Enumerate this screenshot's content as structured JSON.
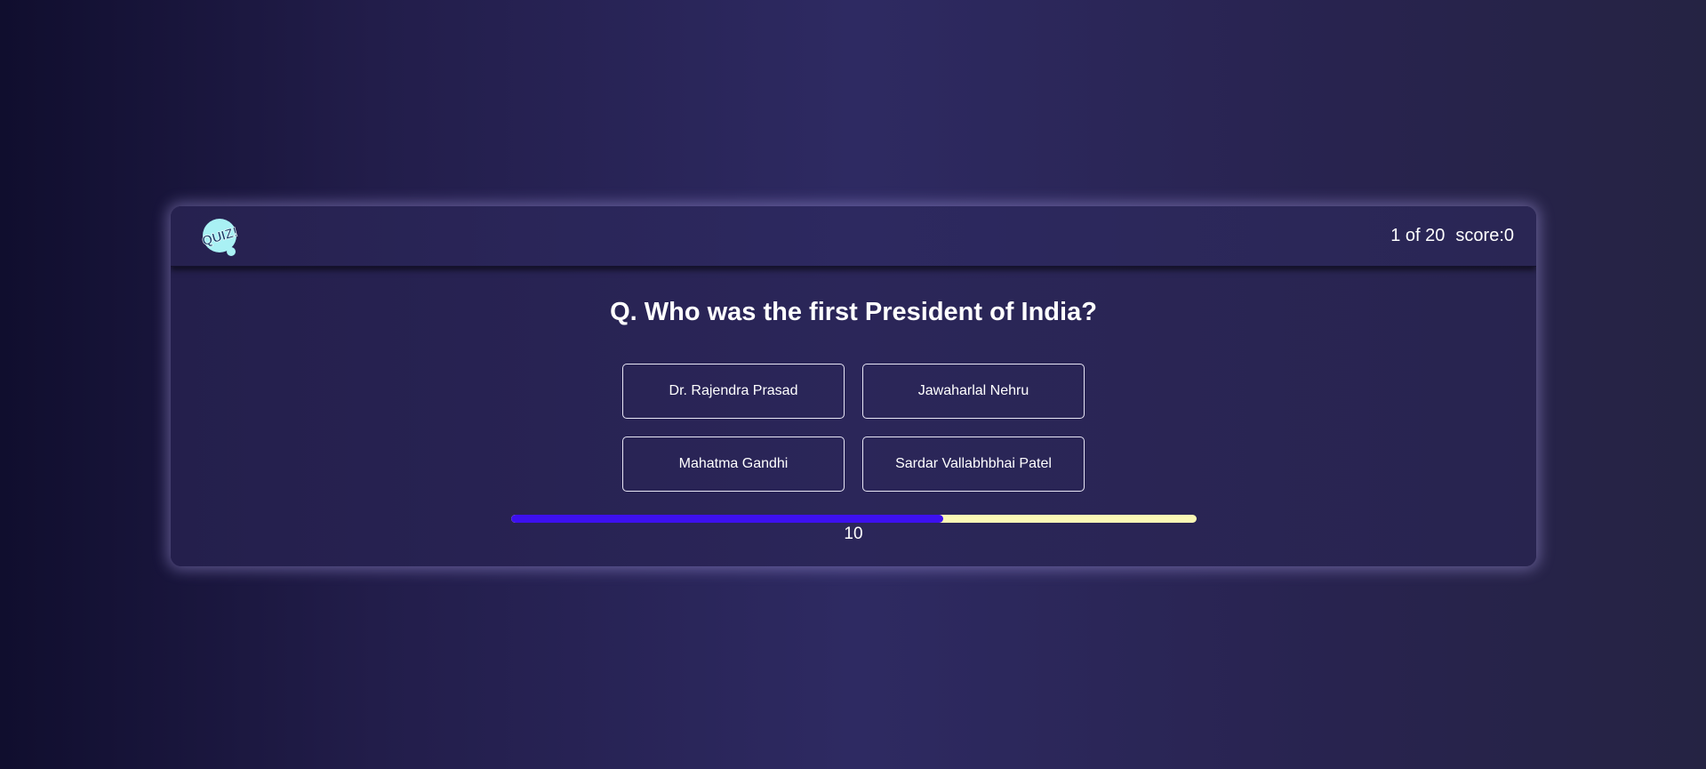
{
  "logo": {
    "icon": "quiz-logo-icon",
    "text": "QUIZ!",
    "color": "#a9f1f4"
  },
  "header": {
    "progress_text": "1 of 20",
    "score_text": "score:0"
  },
  "question": {
    "text": "Q. Who was the first President of India?"
  },
  "options": [
    {
      "label": "Dr. Rajendra Prasad"
    },
    {
      "label": "Jawaharlal Nehru"
    },
    {
      "label": "Mahatma Gandhi"
    },
    {
      "label": "Sardar Vallabhbhai Patel"
    }
  ],
  "timer": {
    "value": "10",
    "fraction_elapsed": 0.63,
    "fill_color": "#3d10f0",
    "track_color": "#fbf8b6"
  }
}
